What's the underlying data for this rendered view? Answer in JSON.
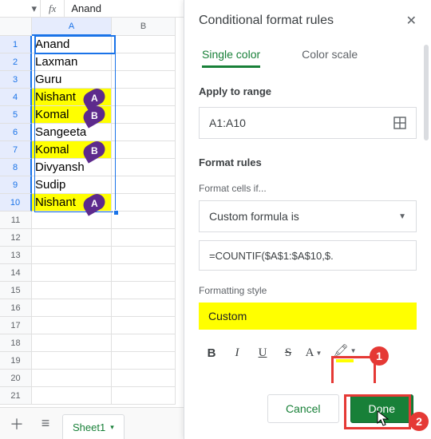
{
  "formula_bar": {
    "caret": "▾",
    "fx": "fx",
    "value": "Anand"
  },
  "columns": [
    "A",
    "B"
  ],
  "rows": [
    {
      "num": 1,
      "value": "Anand",
      "hl": false,
      "pin": null
    },
    {
      "num": 2,
      "value": "Laxman",
      "hl": false,
      "pin": null
    },
    {
      "num": 3,
      "value": "Guru",
      "hl": false,
      "pin": null
    },
    {
      "num": 4,
      "value": "Nishant",
      "hl": true,
      "pin": "A"
    },
    {
      "num": 5,
      "value": "Komal",
      "hl": true,
      "pin": "B"
    },
    {
      "num": 6,
      "value": "Sangeeta",
      "hl": false,
      "pin": null
    },
    {
      "num": 7,
      "value": "Komal",
      "hl": true,
      "pin": "B"
    },
    {
      "num": 8,
      "value": "Divyansh",
      "hl": false,
      "pin": null
    },
    {
      "num": 9,
      "value": "Sudip",
      "hl": false,
      "pin": null
    },
    {
      "num": 10,
      "value": "Nishant",
      "hl": true,
      "pin": "A"
    }
  ],
  "blank_rows": 11,
  "sheet_tabs": {
    "add": "＋",
    "all": "≡",
    "active": "Sheet1",
    "caret": "▾"
  },
  "panel": {
    "title": "Conditional format rules",
    "tabs": {
      "single": "Single color",
      "scale": "Color scale"
    },
    "apply_label": "Apply to range",
    "range_value": "A1:A10",
    "rules_label": "Format rules",
    "cells_if_label": "Format cells if...",
    "condition_value": "Custom formula is",
    "formula_value": "=COUNTIF($A$1:$A$10,$.",
    "style_label": "Formatting style",
    "style_preview": "Custom",
    "toolbar": {
      "b": "B",
      "i": "I",
      "u": "U",
      "s": "S",
      "a": "A"
    },
    "cancel": "Cancel",
    "done": "Done"
  },
  "callouts": {
    "one": "1",
    "two": "2"
  }
}
